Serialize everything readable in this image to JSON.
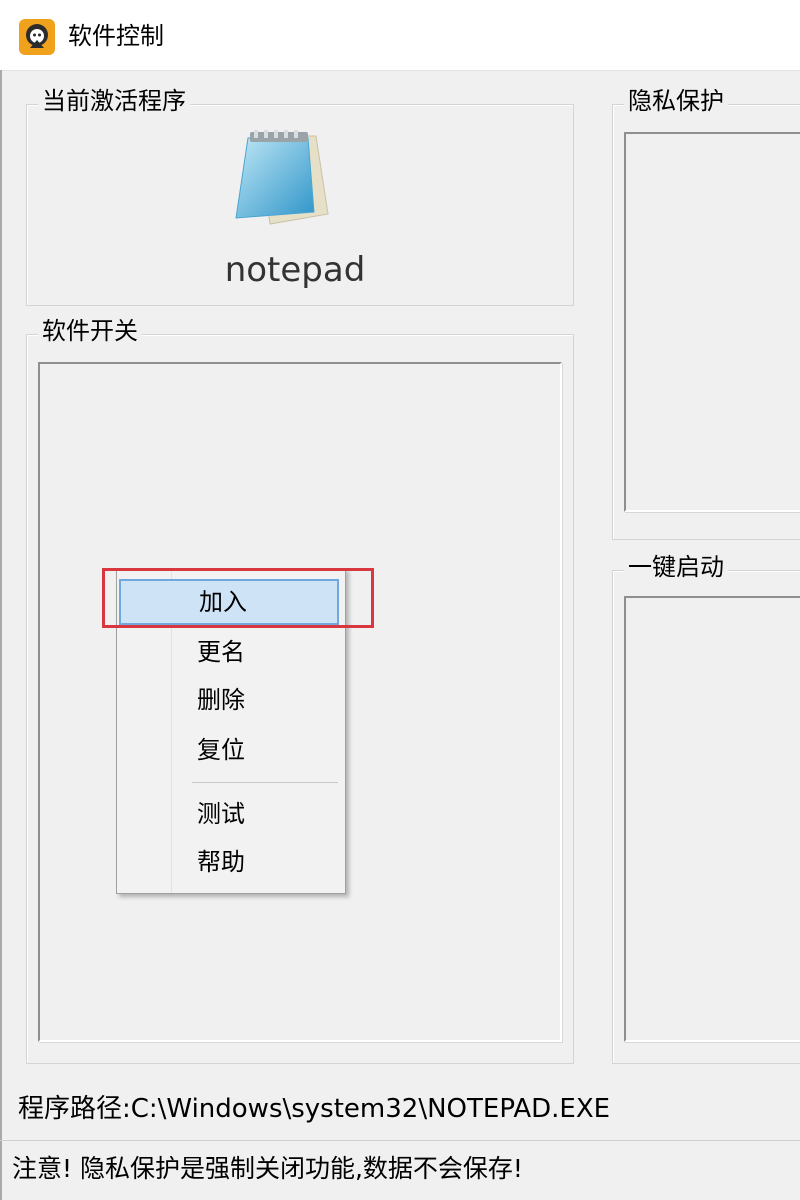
{
  "window": {
    "title": "软件控制",
    "icon": "app-logo-icon"
  },
  "active_program": {
    "group_label": "当前激活程序",
    "icon": "notepad-icon",
    "name": "notepad"
  },
  "software_switch": {
    "group_label": "软件开关"
  },
  "privacy": {
    "group_label": "隐私保护"
  },
  "quick_start": {
    "group_label": "一键启动"
  },
  "context_menu": {
    "items": [
      {
        "label": "加入",
        "highlighted": true
      },
      {
        "label": "更名"
      },
      {
        "label": "删除"
      },
      {
        "label": "复位"
      },
      {
        "label": "测试"
      },
      {
        "label": "帮助"
      }
    ]
  },
  "path": {
    "text": "程序路径:C:\\Windows\\system32\\NOTEPAD.EXE"
  },
  "status": {
    "text": "注意! 隐私保护是强制关闭功能,数据不会保存!"
  },
  "colors": {
    "highlight": "#cfe3f7",
    "highlight_border": "#6fa8dc",
    "annotation": "#d9373f"
  }
}
